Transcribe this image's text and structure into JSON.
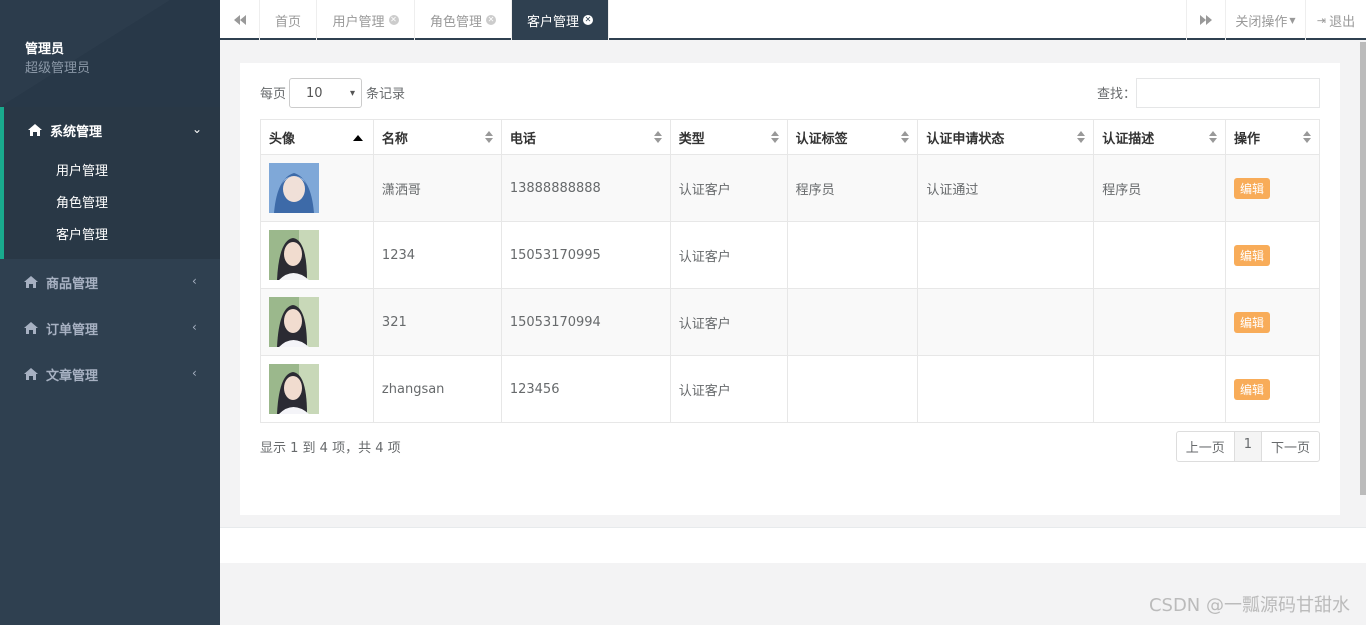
{
  "sidebar": {
    "profile_name": "管理员",
    "profile_role": "超级管理员",
    "menus": [
      {
        "label": "系统管理",
        "icon": "home-icon",
        "active": true,
        "subs": [
          "用户管理",
          "角色管理",
          "客户管理"
        ]
      },
      {
        "label": "商品管理",
        "icon": "home-icon"
      },
      {
        "label": "订单管理",
        "icon": "home-icon"
      },
      {
        "label": "文章管理",
        "icon": "home-icon"
      }
    ]
  },
  "topbar": {
    "tabs": [
      "首页",
      "用户管理",
      "角色管理",
      "客户管理"
    ],
    "active_tab": "客户管理",
    "close_ops": "关闭操作",
    "logout": "退出"
  },
  "table_controls": {
    "per_page_prefix": "每页",
    "per_page_value": "10",
    "per_page_suffix": "条记录",
    "search_label": "查找："
  },
  "table": {
    "headers": [
      "头像",
      "名称",
      "电话",
      "类型",
      "认证标签",
      "认证申请状态",
      "认证描述",
      "操作"
    ],
    "rows": [
      {
        "name": "潇洒哥",
        "phone": "13888888888",
        "type": "认证客户",
        "tag": "程序员",
        "status": "认证通过",
        "desc": "程序员",
        "action": "编辑"
      },
      {
        "name": "1234",
        "phone": "15053170995",
        "type": "认证客户",
        "tag": "",
        "status": "",
        "desc": "",
        "action": "编辑"
      },
      {
        "name": "321",
        "phone": "15053170994",
        "type": "认证客户",
        "tag": "",
        "status": "",
        "desc": "",
        "action": "编辑"
      },
      {
        "name": "zhangsan",
        "phone": "123456",
        "type": "认证客户",
        "tag": "",
        "status": "",
        "desc": "",
        "action": "编辑"
      }
    ]
  },
  "footer": {
    "info": "显示 1 到 4 项，共 4 项",
    "prev": "上一页",
    "page": "1",
    "next": "下一页"
  },
  "watermark": "CSDN @一瓢源码甘甜水",
  "colors": {
    "sidebar": "#2f4050",
    "accent": "#19aa8d",
    "edit_button": "#f8ac59"
  }
}
